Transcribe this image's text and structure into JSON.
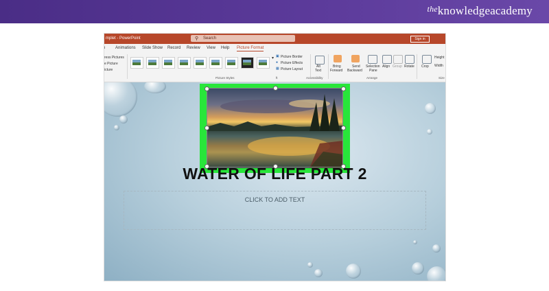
{
  "banner": {
    "brand_prefix": "the",
    "brand_name": "knowledgeacademy",
    "color": "#5b3a9a"
  },
  "window": {
    "app_title": "mplet - PowerPoint",
    "search_placeholder": "Search",
    "sign_in_label": "Sign in",
    "accent": "#b7472a"
  },
  "tabs": [
    "n",
    "Animations",
    "Slide Show",
    "Record",
    "Review",
    "View",
    "Help",
    "Picture Format"
  ],
  "active_tab": "Picture Format",
  "ribbon": {
    "left_items": [
      "ress Pictures",
      "e Picture",
      "icture"
    ],
    "picture_styles_label": "Picture Styles",
    "picture_border": "Picture Border",
    "picture_effects": "Picture Effects",
    "picture_layout": "Picture Layout",
    "styles_group_mark": "ft",
    "alt_text_1": "Alt",
    "alt_text_2": "Text",
    "accessibility_label": "Accessibility",
    "bring_forward_1": "Bring",
    "bring_forward_2": "Forward",
    "send_backward_1": "Send",
    "send_backward_2": "Backward",
    "selection_pane_1": "Selection",
    "selection_pane_2": "Pane",
    "align": "Align",
    "group": "Group",
    "rotate": "Rotate",
    "arrange_label": "Arrange",
    "crop": "Crop",
    "height": "Height",
    "width": "Width",
    "size_label": "Size"
  },
  "slide": {
    "title": "WATER OF LIFE PART 2",
    "placeholder": "CLICK TO ADD TEXT",
    "selection_color": "#28e63a"
  }
}
